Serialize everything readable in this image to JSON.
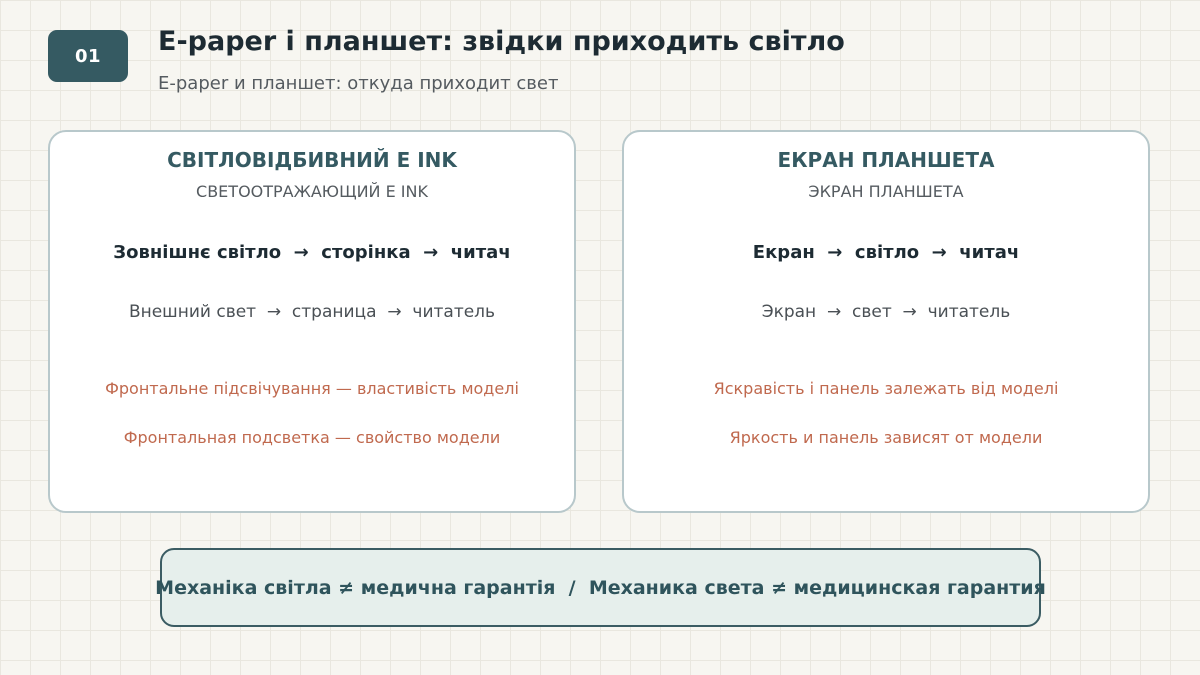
{
  "header": {
    "badge": "01",
    "title": "E-paper і планшет: звідки приходить світло",
    "subtitle": "E-paper и планшет: откуда приходит свет"
  },
  "cards": [
    {
      "title": "СВІТЛОВІДБИВНИЙ E INK",
      "subtitle": "СВЕТООТРАЖАЮЩИЙ E INK",
      "flow_uk": "Зовнішнє світло  →  сторінка  →  читач",
      "flow_ru": "Внешний свет  →  страница  →  читатель",
      "note_uk": "Фронтальне підсвічування — властивість моделі",
      "note_ru": "Фронтальная подсветка — свойство модели"
    },
    {
      "title": "ЕКРАН ПЛАНШЕТА",
      "subtitle": "ЭКРАН ПЛАНШЕТА",
      "flow_uk": "Екран  →  світло  →  читач",
      "flow_ru": "Экран  →  свет  →  читатель",
      "note_uk": "Яскравість і панель залежать від моделі",
      "note_ru": "Яркость и панель зависят от модели"
    }
  ],
  "footer": {
    "statement": "Механіка світла ≠ медична гарантія  /  Механика света ≠ медицинская гарантия"
  },
  "colors": {
    "accent": "#355a62",
    "note": "#c0694e",
    "background": "#f7f6f1"
  }
}
